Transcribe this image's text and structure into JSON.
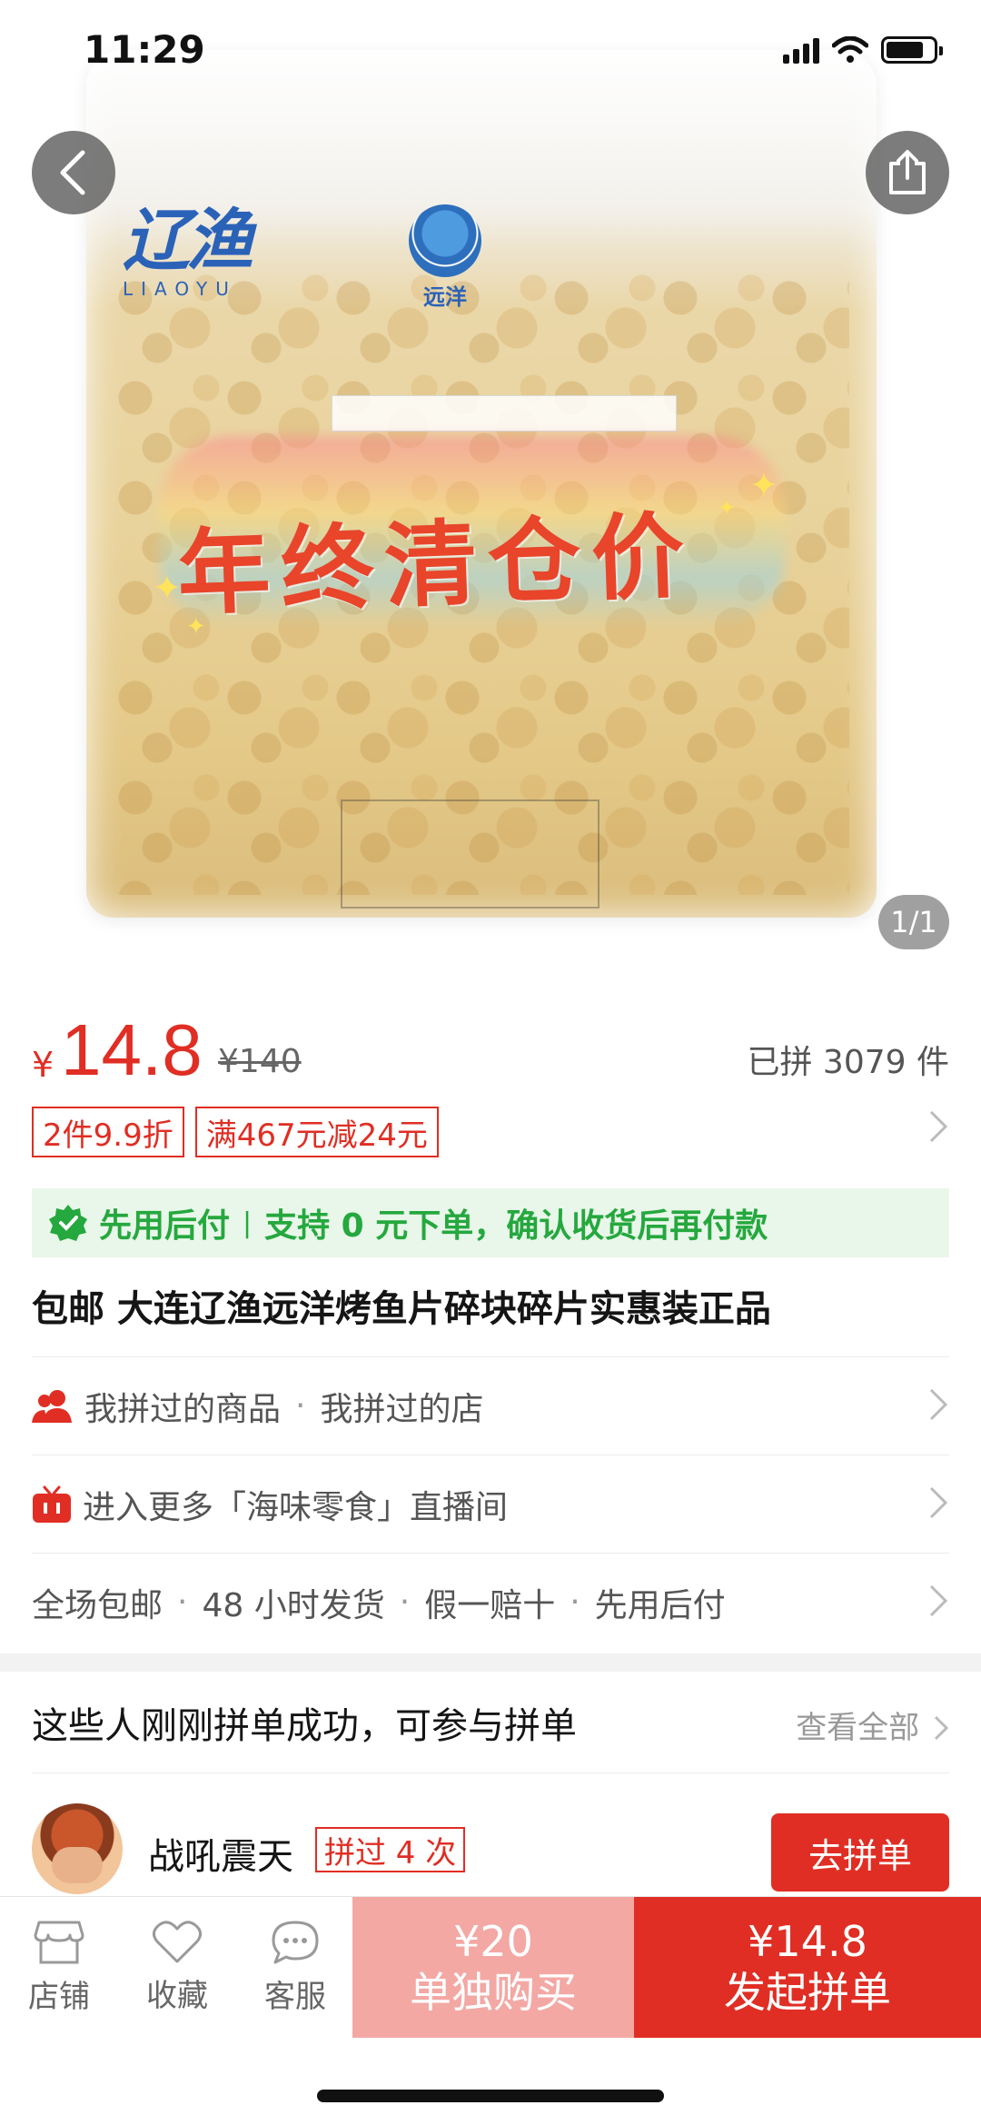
{
  "status_bar": {
    "time": "11:29"
  },
  "gallery": {
    "page_indicator": "1/1",
    "brand_cn": "辽渔",
    "brand_en": "LIAOYU",
    "sub_brand": "远洋",
    "promo_text": "年终清仓价"
  },
  "price": {
    "currency": "¥",
    "current": "14.8",
    "original": "¥140",
    "sold": "已拼 3079 件"
  },
  "tags": [
    "2件9.9折",
    "满467元减24元"
  ],
  "paylater": {
    "label": "先用后付",
    "desc": "支持 0 元下单，确认收货后再付款"
  },
  "product_title": "包邮 大连辽渔远洋烤鱼片碎块碎片实惠装正品",
  "rows": {
    "history_goods": "我拼过的商品",
    "history_shop": "我拼过的店",
    "live": "进入更多「海味零食」直播间",
    "services": [
      "全场包邮",
      "48 小时发货",
      "假一赔十",
      "先用后付"
    ]
  },
  "group_buy": {
    "title": "这些人刚刚拼单成功，可参与拼单",
    "view_all": "查看全部",
    "user": {
      "name": "战吼震天",
      "badge": "拼过 4 次",
      "button": "去拼单"
    }
  },
  "bottom_bar": {
    "store": "店铺",
    "favorite": "收藏",
    "service": "客服",
    "single_price": "¥20",
    "single_label": "单独购买",
    "group_price": "¥14.8",
    "group_label": "发起拼单"
  },
  "colors": {
    "brand_red": "#e02e24",
    "light_red": "#f3a8a4",
    "green": "#25a83e"
  }
}
